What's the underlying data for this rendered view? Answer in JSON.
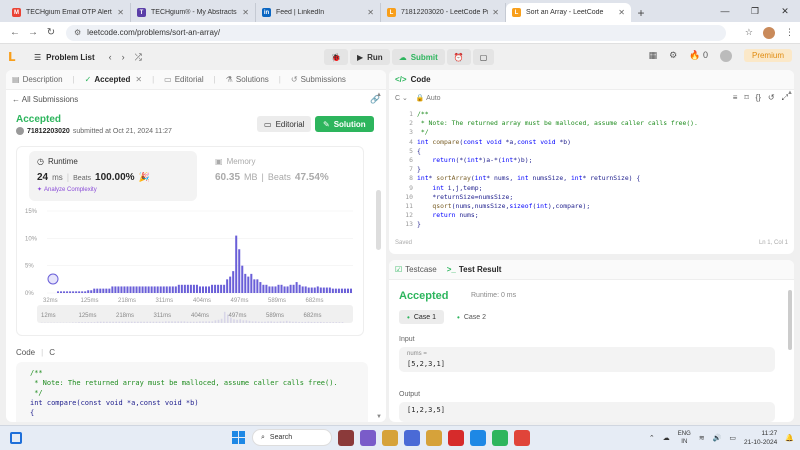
{
  "browser": {
    "tabs": [
      {
        "title": "TECHgium Email OTP Alert - gm",
        "favicon": "gmail-icon",
        "color": "#ea4335",
        "glyph": "M"
      },
      {
        "title": "TECHgium® - My Abstracts",
        "favicon": "techgium-icon",
        "color": "#5b3fa8",
        "glyph": "T"
      },
      {
        "title": "Feed | LinkedIn",
        "favicon": "linkedin-icon",
        "color": "#0a66c2",
        "glyph": "in"
      },
      {
        "title": "71812203020 - LeetCode Profile",
        "favicon": "leetcode-icon",
        "color": "#f89f1b",
        "glyph": "L"
      },
      {
        "title": "Sort an Array - LeetCode",
        "favicon": "leetcode-icon",
        "color": "#f89f1b",
        "glyph": "L"
      }
    ],
    "url": "leetcode.com/problems/sort-an-array/"
  },
  "lc_header": {
    "problem_list": "Problem List",
    "run": "Run",
    "submit": "Submit",
    "streak": "0",
    "premium": "Premium"
  },
  "left_tabs": [
    {
      "label": "Description",
      "active": false
    },
    {
      "label": "Accepted",
      "active": true
    },
    {
      "label": "Editorial",
      "active": false
    },
    {
      "label": "Solutions",
      "active": false
    },
    {
      "label": "Submissions",
      "active": false
    }
  ],
  "submission": {
    "back": "All Submissions",
    "status": "Accepted",
    "user": "71812203020",
    "submitted_at": "submitted at Oct 21, 2024 11:27",
    "editorial_btn": "Editorial",
    "solution_btn": "Solution"
  },
  "runtime": {
    "label": "Runtime",
    "value": "24",
    "unit": "ms",
    "beats_label": "Beats",
    "beats_pct": "100.00%",
    "analyze": "Analyze Complexity"
  },
  "memory": {
    "label": "Memory",
    "value": "60.35",
    "unit": "MB",
    "beats_label": "Beats",
    "beats_pct": "47.54%"
  },
  "chart_data": {
    "type": "bar",
    "y_ticks": [
      "15%",
      "10%",
      "5%",
      "0%"
    ],
    "x_ticks": [
      "32ms",
      "125ms",
      "218ms",
      "311ms",
      "404ms",
      "497ms",
      "589ms",
      "682ms"
    ],
    "mini_ticks": [
      "12ms",
      "125ms",
      "218ms",
      "311ms",
      "404ms",
      "497ms",
      "589ms",
      "682ms"
    ],
    "ylim": [
      0,
      15
    ],
    "values": [
      0.3,
      0.3,
      0.3,
      0.3,
      0.3,
      0.3,
      0.3,
      0.3,
      0.3,
      0.3,
      0.5,
      0.5,
      0.8,
      0.8,
      0.8,
      0.8,
      0.8,
      0.8,
      1.2,
      1.2,
      1.2,
      1.2,
      1.2,
      1.2,
      1.2,
      1.2,
      1.2,
      1.2,
      1.2,
      1.2,
      1.2,
      1.2,
      1.2,
      1.2,
      1.2,
      1.2,
      1.2,
      1.2,
      1.2,
      1.2,
      1.5,
      1.5,
      1.5,
      1.5,
      1.5,
      1.5,
      1.5,
      1.2,
      1.2,
      1.2,
      1.2,
      1.5,
      1.5,
      1.5,
      1.5,
      1.5,
      2.5,
      3,
      4,
      10.5,
      8,
      5,
      3.5,
      3,
      3.5,
      2.5,
      2.5,
      2,
      1.5,
      1.5,
      1.2,
      1.2,
      1.2,
      1.5,
      1.5,
      1.2,
      1.2,
      1.5,
      1.5,
      2,
      1.5,
      1.2,
      1.2,
      1,
      1,
      1,
      1.2,
      1,
      1,
      1,
      1,
      0.8,
      0.8,
      0.8,
      0.8,
      0.8,
      0.8,
      0.8
    ],
    "bar_color": "#6a5fd8"
  },
  "code_section": {
    "label": "Code",
    "lang": "C",
    "preview": [
      "/**",
      " * Note: The returned array must be malloced, assume caller calls free().",
      " */",
      "int compare(const void *a,const void *b)",
      "{"
    ]
  },
  "code_panel": {
    "title": "Code",
    "lang": "C",
    "mode": "Auto",
    "lines": [
      {
        "n": "1",
        "html": "<span class='cmt'>/**</span>"
      },
      {
        "n": "2",
        "html": "<span class='cmt'> * Note: The returned array must be malloced, assume caller calls free().</span>"
      },
      {
        "n": "3",
        "html": "<span class='cmt'> */</span>"
      },
      {
        "n": "4",
        "html": "<span class='type'>int</span> <span class='fn'>compare</span>(<span class='kw'>const</span> <span class='type'>void</span> *a,<span class='kw'>const</span> <span class='type'>void</span> *b)"
      },
      {
        "n": "5",
        "html": "{"
      },
      {
        "n": "6",
        "html": "    <span class='kw'>return</span>(*(<span class='type'>int</span>*)a-*(<span class='type'>int</span>*)b);"
      },
      {
        "n": "7",
        "html": "}"
      },
      {
        "n": "8",
        "html": "<span class='type'>int</span>* <span class='fn'>sortArray</span>(<span class='type'>int</span>* nums, <span class='type'>int</span> numsSize, <span class='type'>int</span>* returnSize) {"
      },
      {
        "n": "9",
        "html": "    <span class='type'>int</span> i,j,temp;"
      },
      {
        "n": "10",
        "html": "    *returnSize=numsSize;"
      },
      {
        "n": "11",
        "html": "    <span class='fn'>qsort</span>(nums,numsSize,<span class='kw'>sizeof</span>(<span class='type'>int</span>),compare);"
      },
      {
        "n": "12",
        "html": "    <span class='kw'>return</span> nums;"
      },
      {
        "n": "13",
        "html": "}"
      }
    ],
    "saved": "Saved",
    "cursor": "Ln 1, Col 1"
  },
  "result_panel": {
    "testcase_tab": "Testcase",
    "result_tab": "Test Result",
    "status": "Accepted",
    "runtime": "Runtime: 0 ms",
    "case1": "Case 1",
    "case2": "Case 2",
    "input_label": "Input",
    "var_name": "nums =",
    "input_value": "[5,2,3,1]",
    "output_label": "Output",
    "output_value": "[1,2,3,5]"
  },
  "taskbar": {
    "search": "Search",
    "lang1": "ENG",
    "lang2": "IN",
    "time": "11:27",
    "date": "21-10-2024"
  }
}
